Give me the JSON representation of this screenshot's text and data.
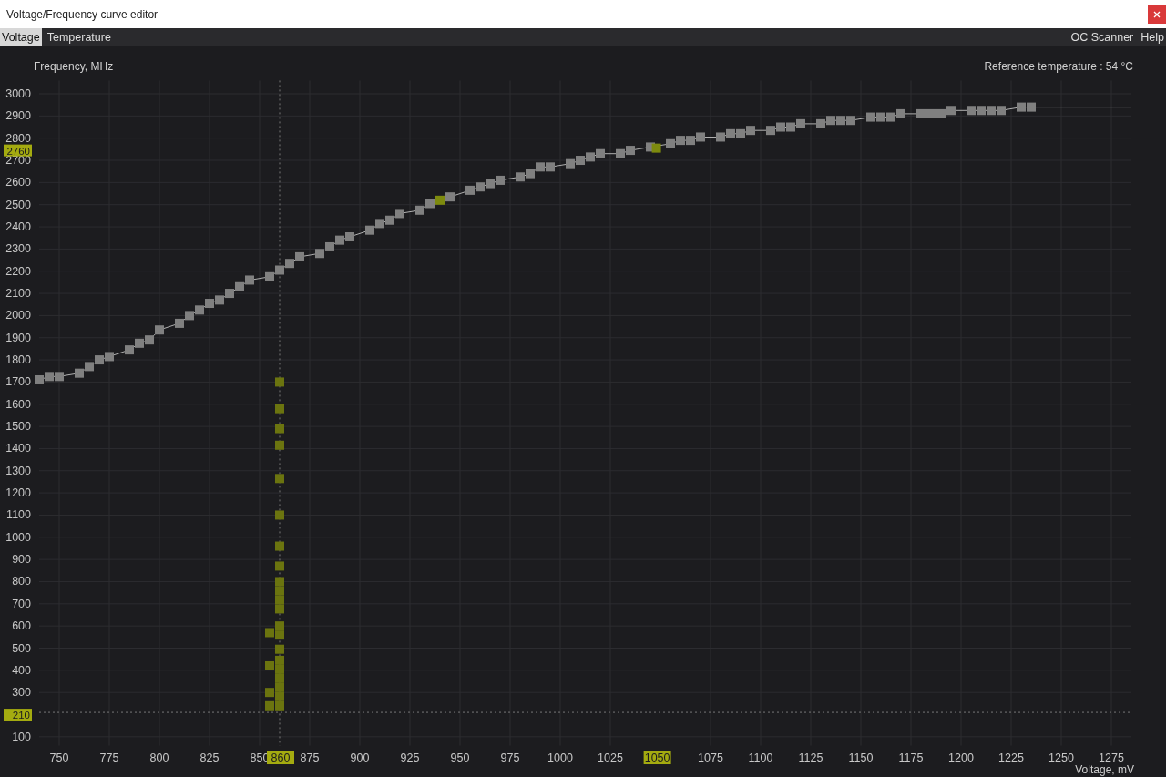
{
  "window": {
    "title": "Voltage/Frequency curve editor"
  },
  "menu": {
    "tabs": [
      {
        "label": "Voltage",
        "selected": true
      },
      {
        "label": "Temperature",
        "selected": false
      }
    ],
    "right": [
      "OC Scanner",
      "Help"
    ]
  },
  "reference_temperature": "Reference temperature : 54 °C",
  "cursor": {
    "frequency": "2760",
    "voltage": "1050"
  },
  "chart_data": {
    "type": "line",
    "xlabel": "Voltage, mV",
    "ylabel": "Frequency, MHz",
    "grid": true,
    "xlim": [
      740,
      1285
    ],
    "ylim": [
      60,
      3060
    ],
    "xticks": [
      750,
      775,
      800,
      825,
      850,
      875,
      900,
      925,
      950,
      975,
      1000,
      1025,
      1075,
      1100,
      1125,
      1150,
      1175,
      1200,
      1225,
      1250,
      1275
    ],
    "yticks": [
      100,
      300,
      400,
      500,
      600,
      700,
      800,
      900,
      1000,
      1100,
      1200,
      1300,
      1400,
      1500,
      1600,
      1700,
      1800,
      1900,
      2000,
      2100,
      2200,
      2300,
      2400,
      2500,
      2600,
      2700,
      2800,
      2900,
      3000
    ],
    "series": [
      {
        "marker": "square",
        "color": "#808080",
        "x": [
          740,
          745,
          750,
          760,
          765,
          770,
          775,
          785,
          790,
          795,
          800,
          810,
          815,
          820,
          825,
          830,
          835,
          840,
          845,
          855,
          860,
          865,
          870,
          880,
          885,
          890,
          895,
          905,
          910,
          915,
          920,
          930,
          935,
          945,
          955,
          960,
          965,
          970,
          980,
          985,
          990,
          995,
          1005,
          1010,
          1015,
          1020,
          1030,
          1035,
          1045,
          1055,
          1060,
          1065,
          1070,
          1080,
          1085,
          1090,
          1095,
          1105,
          1110,
          1115,
          1120,
          1130,
          1135,
          1140,
          1145,
          1155,
          1160,
          1165,
          1170,
          1180,
          1185,
          1190,
          1195,
          1205,
          1210,
          1215,
          1220,
          1230,
          1235,
          1285
        ],
        "values": [
          1710,
          1725,
          1725,
          1740,
          1770,
          1800,
          1815,
          1845,
          1875,
          1890,
          1935,
          1965,
          2000,
          2025,
          2055,
          2070,
          2100,
          2130,
          2160,
          2175,
          2205,
          2235,
          2265,
          2280,
          2310,
          2340,
          2355,
          2385,
          2415,
          2430,
          2460,
          2475,
          2505,
          2535,
          2565,
          2580,
          2595,
          2610,
          2625,
          2640,
          2670,
          2670,
          2685,
          2700,
          2715,
          2730,
          2730,
          2745,
          2760,
          2775,
          2790,
          2790,
          2805,
          2805,
          2820,
          2820,
          2835,
          2835,
          2850,
          2850,
          2865,
          2865,
          2880,
          2880,
          2880,
          2895,
          2895,
          2895,
          2910,
          2910,
          2910,
          2910,
          2925,
          2925,
          2925,
          2925,
          2925,
          2940,
          2940,
          2940
        ]
      },
      {
        "type": "scatter",
        "color": "#7d8a0e",
        "x": [
          940,
          1048
        ],
        "values": [
          2520,
          2755
        ]
      },
      {
        "type": "scatter",
        "color": "#6b740f",
        "x": [
          860,
          860,
          860,
          860,
          860,
          860,
          860,
          860,
          860,
          860,
          860,
          860,
          860,
          860,
          860,
          860,
          860,
          860,
          860,
          860,
          860,
          855,
          855,
          855,
          855
        ],
        "values": [
          1700,
          1580,
          1490,
          1415,
          1265,
          1100,
          960,
          870,
          800,
          759,
          718,
          677,
          600,
          559,
          495,
          445,
          404,
          363,
          322,
          281,
          240,
          570,
          420,
          300,
          240
        ]
      }
    ],
    "ref_lines": [
      {
        "axis": "y",
        "value": 210,
        "label": "210"
      },
      {
        "axis": "x",
        "value": 860,
        "label": "860"
      }
    ]
  }
}
